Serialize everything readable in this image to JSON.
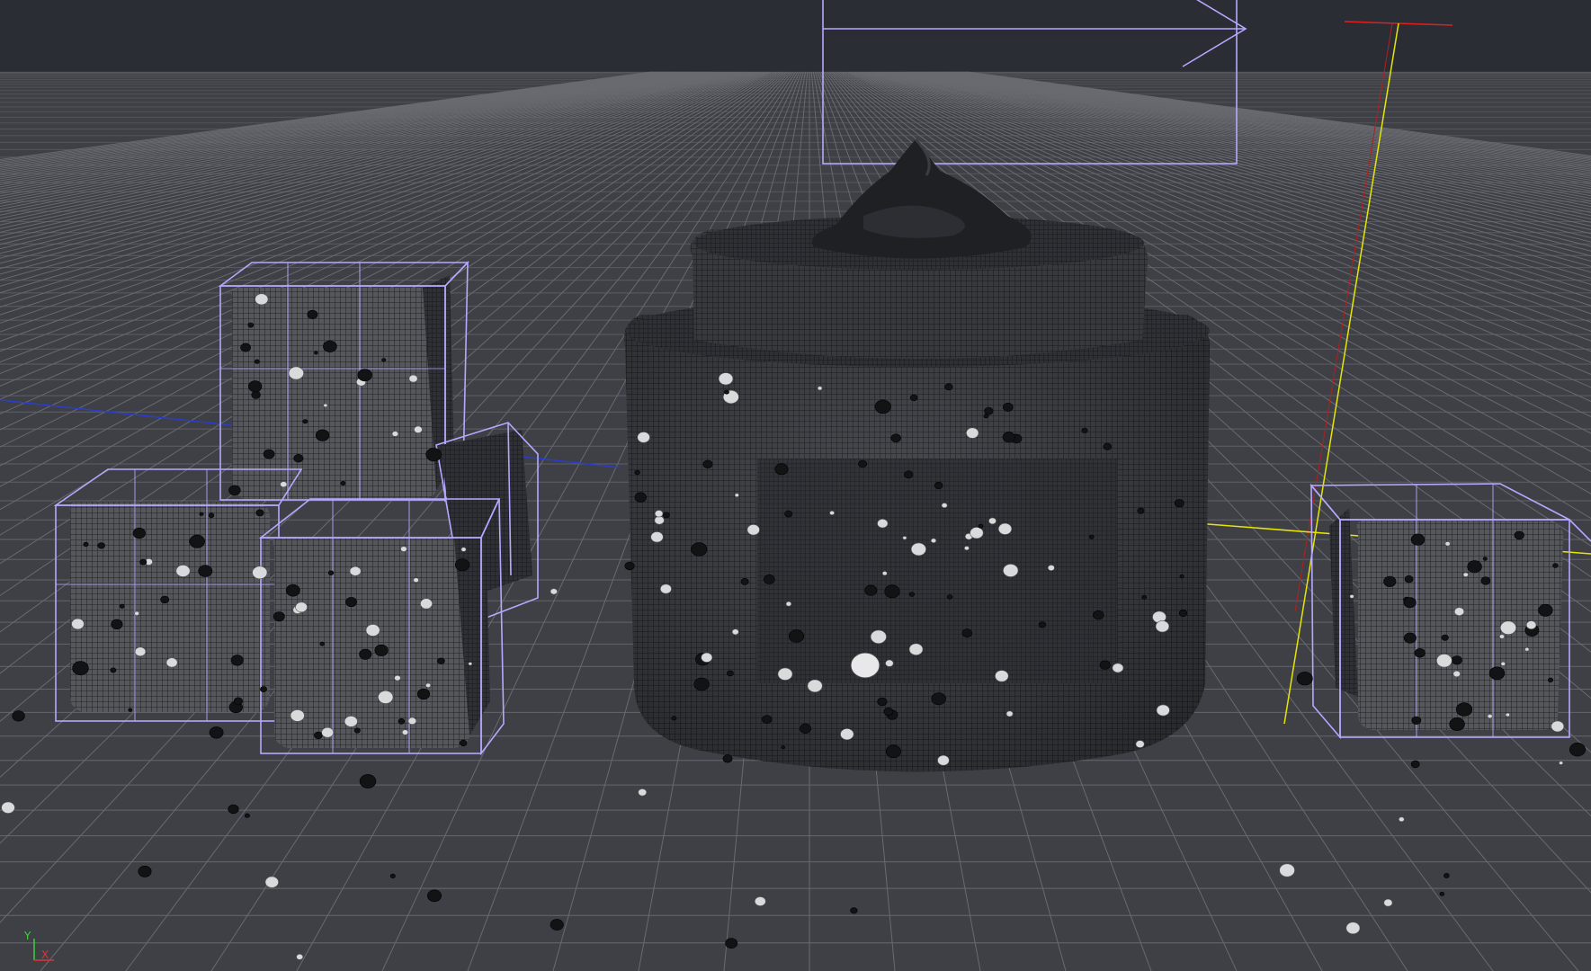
{
  "viewport": {
    "background": "#2a2d33",
    "floor_color": "#3f4147",
    "grid_color": "#8a8d92",
    "wire_color": "#b6a8ff",
    "mesh_dark": "#1c1e22",
    "axis_x_color": "#e02020",
    "axis_y_color": "#e6e600",
    "axis_z_color": "#2b3dcc"
  },
  "axis_gizmo": {
    "y_label": "Y",
    "x_label": "X"
  },
  "scene": {
    "object_kinds": [
      "camera-frame",
      "jar-mesh",
      "cube-mesh",
      "cube-mesh",
      "cube-mesh",
      "cube-mesh",
      "cube-mesh",
      "debris-particles"
    ]
  }
}
